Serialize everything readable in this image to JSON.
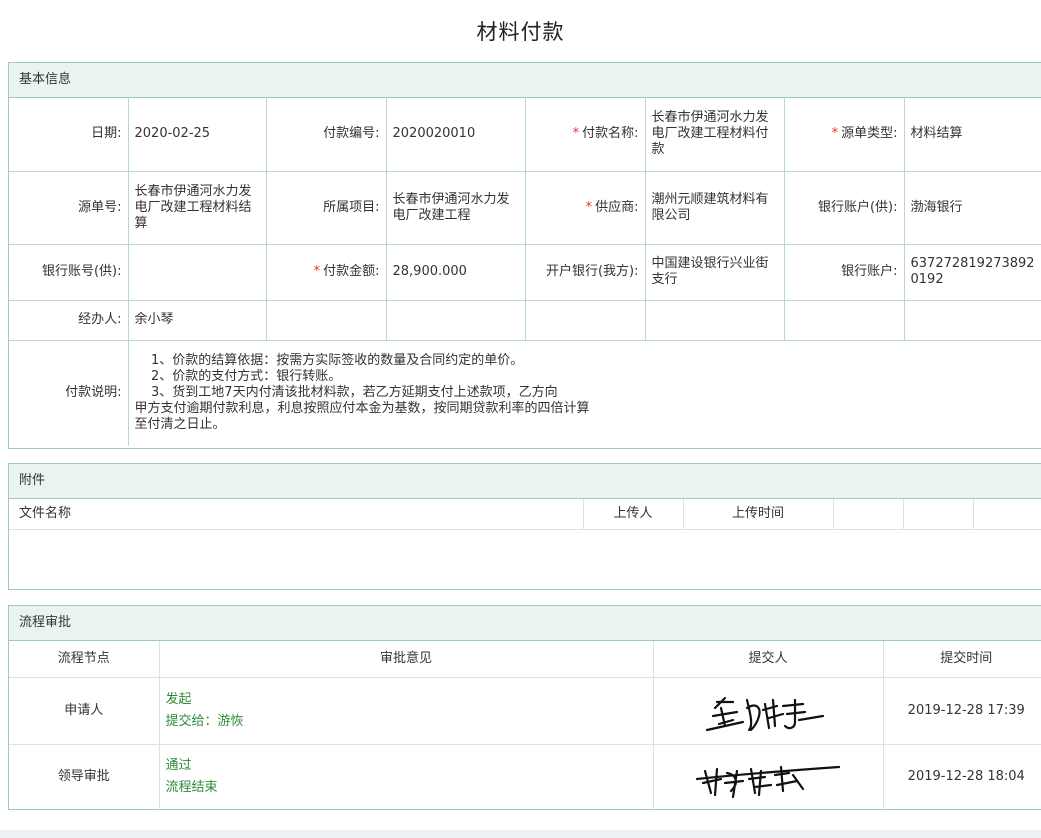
{
  "title": "材料付款",
  "basic": {
    "header": "基本信息",
    "date_label": "日期:",
    "date": "2020-02-25",
    "pay_no_label": "付款编号:",
    "pay_no": "2020020010",
    "pay_name_label": "付款名称:",
    "pay_name": "长春市伊通河水力发电厂改建工程材料付款",
    "source_type_label": "源单类型:",
    "source_type": "材料结算",
    "source_no_label": "源单号:",
    "source_no": "长春市伊通河水力发电厂改建工程材料结算",
    "project_label": "所属项目:",
    "project": "长春市伊通河水力发电厂改建工程",
    "supplier_label": "供应商:",
    "supplier": "潮州元顺建筑材料有限公司",
    "bank_supplier_label": "银行账户(供):",
    "bank_supplier": "渤海银行",
    "bank_no_supplier_label": "银行账号(供):",
    "bank_no_supplier": "",
    "amount_label": "付款金额:",
    "amount": "28,900.000",
    "our_bank_label": "开户银行(我方):",
    "our_bank": "中国建设银行兴业街支行",
    "bank_account_label": "银行账户:",
    "bank_account": "6372728192738920192",
    "handler_label": "经办人:",
    "handler": "余小琴",
    "note_label": "付款说明:",
    "note_lines": [
      "    1、价款的结算依据：按需方实际签收的数量及合同约定的单价。",
      "    2、价款的支付方式：银行转账。",
      "    3、货到工地7天内付清该批材料款，若乙方延期支付上述款项，乙方向",
      "甲方支付逾期付款利息，利息按照应付本金为基数，按同期贷款利率的四倍计算",
      "至付清之日止。"
    ],
    "required_mark": "*"
  },
  "attachments": {
    "header": "附件",
    "columns": [
      "文件名称",
      "上传人",
      "上传时间"
    ]
  },
  "workflow": {
    "header": "流程审批",
    "columns": [
      "流程节点",
      "审批意见",
      "提交人",
      "提交时间"
    ],
    "rows": [
      {
        "node": "申请人",
        "opinion_1": "发起",
        "opinion_2": "提交给：游恢",
        "time": "2019-12-28 17:39"
      },
      {
        "node": "领导审批",
        "opinion_1": "通过",
        "opinion_2": "流程结束",
        "time": "2019-12-28 18:04"
      }
    ]
  },
  "colors": {
    "panel_border": "#9fc7c7",
    "panel_header_bg": "#e9f4f2",
    "required": "#e23232",
    "approval_text": "#2e8b3a"
  }
}
